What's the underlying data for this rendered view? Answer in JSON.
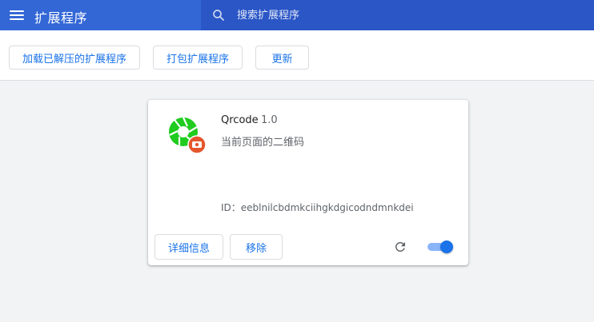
{
  "header": {
    "title": "扩展程序",
    "search_placeholder": "搜索扩展程序",
    "search_value": ""
  },
  "toolbar": {
    "load_unpacked_label": "加载已解压的扩展程序",
    "pack_label": "打包扩展程序",
    "update_label": "更新"
  },
  "extension": {
    "name": "Qrcode",
    "version": "1.0",
    "description": "当前页面的二维码",
    "id_text": "ID：eeblnilcbdmkciihgkdgicodndmnkdei",
    "details_label": "详细信息",
    "remove_label": "移除",
    "enabled": true,
    "icons": {
      "extension": "green-shutter-icon",
      "badge": "camera-badge-icon",
      "reload": "reload-icon"
    }
  },
  "colors": {
    "header_bg": "#3367d6",
    "search_bg": "#2a56c6",
    "accent": "#1a73e8",
    "icon_green": "#1fcc1f",
    "badge_orange": "#e4572e"
  }
}
